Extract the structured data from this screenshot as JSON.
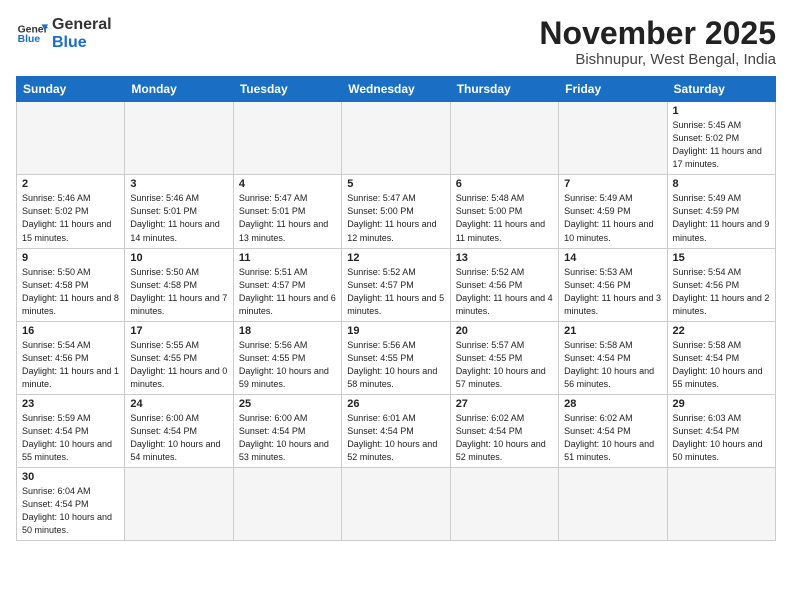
{
  "logo": {
    "text_general": "General",
    "text_blue": "Blue"
  },
  "header": {
    "month_title": "November 2025",
    "location": "Bishnupur, West Bengal, India"
  },
  "weekdays": [
    "Sunday",
    "Monday",
    "Tuesday",
    "Wednesday",
    "Thursday",
    "Friday",
    "Saturday"
  ],
  "weeks": [
    [
      {
        "day": "",
        "empty": true
      },
      {
        "day": "",
        "empty": true
      },
      {
        "day": "",
        "empty": true
      },
      {
        "day": "",
        "empty": true
      },
      {
        "day": "",
        "empty": true
      },
      {
        "day": "",
        "empty": true
      },
      {
        "day": "1",
        "sunrise": "5:45 AM",
        "sunset": "5:02 PM",
        "daylight": "11 hours and 17 minutes."
      }
    ],
    [
      {
        "day": "2",
        "sunrise": "5:46 AM",
        "sunset": "5:02 PM",
        "daylight": "11 hours and 15 minutes."
      },
      {
        "day": "3",
        "sunrise": "5:46 AM",
        "sunset": "5:01 PM",
        "daylight": "11 hours and 14 minutes."
      },
      {
        "day": "4",
        "sunrise": "5:47 AM",
        "sunset": "5:01 PM",
        "daylight": "11 hours and 13 minutes."
      },
      {
        "day": "5",
        "sunrise": "5:47 AM",
        "sunset": "5:00 PM",
        "daylight": "11 hours and 12 minutes."
      },
      {
        "day": "6",
        "sunrise": "5:48 AM",
        "sunset": "5:00 PM",
        "daylight": "11 hours and 11 minutes."
      },
      {
        "day": "7",
        "sunrise": "5:49 AM",
        "sunset": "4:59 PM",
        "daylight": "11 hours and 10 minutes."
      },
      {
        "day": "8",
        "sunrise": "5:49 AM",
        "sunset": "4:59 PM",
        "daylight": "11 hours and 9 minutes."
      }
    ],
    [
      {
        "day": "9",
        "sunrise": "5:50 AM",
        "sunset": "4:58 PM",
        "daylight": "11 hours and 8 minutes."
      },
      {
        "day": "10",
        "sunrise": "5:50 AM",
        "sunset": "4:58 PM",
        "daylight": "11 hours and 7 minutes."
      },
      {
        "day": "11",
        "sunrise": "5:51 AM",
        "sunset": "4:57 PM",
        "daylight": "11 hours and 6 minutes."
      },
      {
        "day": "12",
        "sunrise": "5:52 AM",
        "sunset": "4:57 PM",
        "daylight": "11 hours and 5 minutes."
      },
      {
        "day": "13",
        "sunrise": "5:52 AM",
        "sunset": "4:56 PM",
        "daylight": "11 hours and 4 minutes."
      },
      {
        "day": "14",
        "sunrise": "5:53 AM",
        "sunset": "4:56 PM",
        "daylight": "11 hours and 3 minutes."
      },
      {
        "day": "15",
        "sunrise": "5:54 AM",
        "sunset": "4:56 PM",
        "daylight": "11 hours and 2 minutes."
      }
    ],
    [
      {
        "day": "16",
        "sunrise": "5:54 AM",
        "sunset": "4:56 PM",
        "daylight": "11 hours and 1 minute."
      },
      {
        "day": "17",
        "sunrise": "5:55 AM",
        "sunset": "4:55 PM",
        "daylight": "11 hours and 0 minutes."
      },
      {
        "day": "18",
        "sunrise": "5:56 AM",
        "sunset": "4:55 PM",
        "daylight": "10 hours and 59 minutes."
      },
      {
        "day": "19",
        "sunrise": "5:56 AM",
        "sunset": "4:55 PM",
        "daylight": "10 hours and 58 minutes."
      },
      {
        "day": "20",
        "sunrise": "5:57 AM",
        "sunset": "4:55 PM",
        "daylight": "10 hours and 57 minutes."
      },
      {
        "day": "21",
        "sunrise": "5:58 AM",
        "sunset": "4:54 PM",
        "daylight": "10 hours and 56 minutes."
      },
      {
        "day": "22",
        "sunrise": "5:58 AM",
        "sunset": "4:54 PM",
        "daylight": "10 hours and 55 minutes."
      }
    ],
    [
      {
        "day": "23",
        "sunrise": "5:59 AM",
        "sunset": "4:54 PM",
        "daylight": "10 hours and 55 minutes."
      },
      {
        "day": "24",
        "sunrise": "6:00 AM",
        "sunset": "4:54 PM",
        "daylight": "10 hours and 54 minutes."
      },
      {
        "day": "25",
        "sunrise": "6:00 AM",
        "sunset": "4:54 PM",
        "daylight": "10 hours and 53 minutes."
      },
      {
        "day": "26",
        "sunrise": "6:01 AM",
        "sunset": "4:54 PM",
        "daylight": "10 hours and 52 minutes."
      },
      {
        "day": "27",
        "sunrise": "6:02 AM",
        "sunset": "4:54 PM",
        "daylight": "10 hours and 52 minutes."
      },
      {
        "day": "28",
        "sunrise": "6:02 AM",
        "sunset": "4:54 PM",
        "daylight": "10 hours and 51 minutes."
      },
      {
        "day": "29",
        "sunrise": "6:03 AM",
        "sunset": "4:54 PM",
        "daylight": "10 hours and 50 minutes."
      }
    ],
    [
      {
        "day": "30",
        "sunrise": "6:04 AM",
        "sunset": "4:54 PM",
        "daylight": "10 hours and 50 minutes."
      },
      {
        "day": "",
        "empty": true
      },
      {
        "day": "",
        "empty": true
      },
      {
        "day": "",
        "empty": true
      },
      {
        "day": "",
        "empty": true
      },
      {
        "day": "",
        "empty": true
      },
      {
        "day": "",
        "empty": true
      }
    ]
  ]
}
